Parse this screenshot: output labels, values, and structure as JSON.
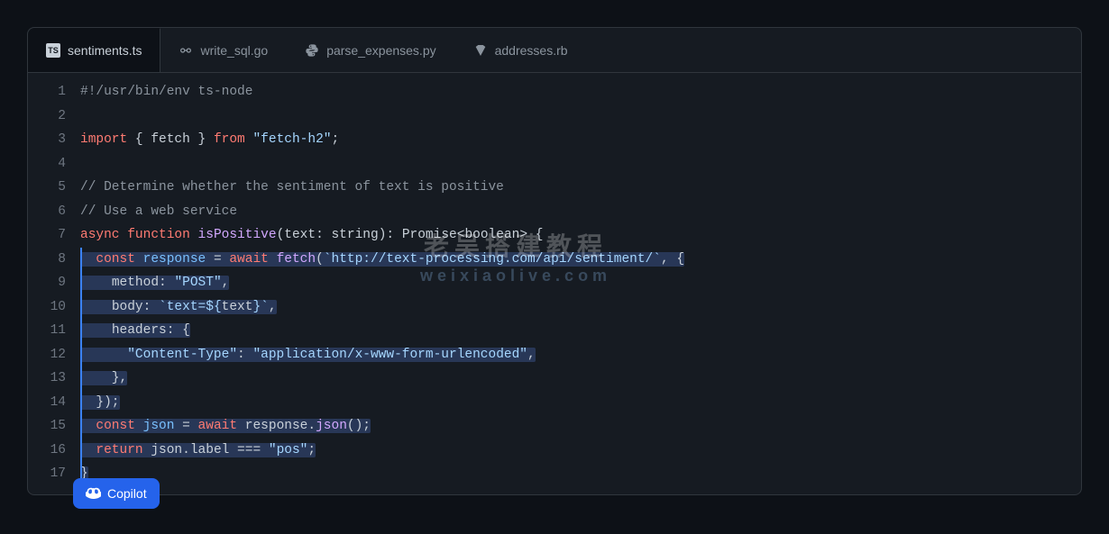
{
  "tabs": [
    {
      "label": "sentiments.ts",
      "icon": "ts-icon",
      "active": true
    },
    {
      "label": "write_sql.go",
      "icon": "go-icon",
      "active": false
    },
    {
      "label": "parse_expenses.py",
      "icon": "python-icon",
      "active": false
    },
    {
      "label": "addresses.rb",
      "icon": "ruby-icon",
      "active": false
    }
  ],
  "copilot_label": "Copilot",
  "watermark": {
    "line1": "老吴搭建教程",
    "line2": "weixiaolive.com"
  },
  "code": {
    "lines": [
      {
        "n": 1,
        "sel": false,
        "tokens": [
          [
            "comment",
            "#!/usr/bin/env ts-node"
          ]
        ]
      },
      {
        "n": 2,
        "sel": false,
        "tokens": []
      },
      {
        "n": 3,
        "sel": false,
        "tokens": [
          [
            "keyword",
            "import"
          ],
          [
            "punc",
            " { "
          ],
          [
            "var",
            "fetch"
          ],
          [
            "punc",
            " } "
          ],
          [
            "keyword",
            "from"
          ],
          [
            "punc",
            " "
          ],
          [
            "string",
            "\"fetch-h2\""
          ],
          [
            "punc",
            ";"
          ]
        ]
      },
      {
        "n": 4,
        "sel": false,
        "tokens": []
      },
      {
        "n": 5,
        "sel": false,
        "tokens": [
          [
            "comment",
            "// Determine whether the sentiment of text is positive"
          ]
        ]
      },
      {
        "n": 6,
        "sel": false,
        "tokens": [
          [
            "comment",
            "// Use a web service"
          ]
        ]
      },
      {
        "n": 7,
        "sel": false,
        "tokens": [
          [
            "keyword",
            "async"
          ],
          [
            "punc",
            " "
          ],
          [
            "keyword",
            "function"
          ],
          [
            "punc",
            " "
          ],
          [
            "func",
            "isPositive"
          ],
          [
            "punc",
            "("
          ],
          [
            "var",
            "text"
          ],
          [
            "punc",
            ": "
          ],
          [
            "type",
            "string"
          ],
          [
            "punc",
            "): "
          ],
          [
            "type",
            "Promise"
          ],
          [
            "punc",
            "<"
          ],
          [
            "type",
            "boolean"
          ],
          [
            "punc",
            "> {"
          ]
        ]
      },
      {
        "n": 8,
        "sel": true,
        "tokens": [
          [
            "punc",
            "  "
          ],
          [
            "keyword",
            "const"
          ],
          [
            "punc",
            " "
          ],
          [
            "ident",
            "response"
          ],
          [
            "punc",
            " = "
          ],
          [
            "keyword",
            "await"
          ],
          [
            "punc",
            " "
          ],
          [
            "func",
            "fetch"
          ],
          [
            "punc",
            "("
          ],
          [
            "string",
            "`http://text-processing.com/api/sentiment/`"
          ],
          [
            "punc",
            ", {"
          ]
        ]
      },
      {
        "n": 9,
        "sel": true,
        "tokens": [
          [
            "punc",
            "    "
          ],
          [
            "var",
            "method"
          ],
          [
            "punc",
            ": "
          ],
          [
            "string",
            "\"POST\""
          ],
          [
            "punc",
            ","
          ]
        ]
      },
      {
        "n": 10,
        "sel": true,
        "tokens": [
          [
            "punc",
            "    "
          ],
          [
            "var",
            "body"
          ],
          [
            "punc",
            ": "
          ],
          [
            "string",
            "`text=${"
          ],
          [
            "var",
            "text"
          ],
          [
            "string",
            "}`"
          ],
          [
            "punc",
            ","
          ]
        ]
      },
      {
        "n": 11,
        "sel": true,
        "tokens": [
          [
            "punc",
            "    "
          ],
          [
            "var",
            "headers"
          ],
          [
            "punc",
            ": {"
          ]
        ]
      },
      {
        "n": 12,
        "sel": true,
        "tokens": [
          [
            "punc",
            "      "
          ],
          [
            "string",
            "\"Content-Type\""
          ],
          [
            "punc",
            ": "
          ],
          [
            "string",
            "\"application/x-www-form-urlencoded\""
          ],
          [
            "punc",
            ","
          ]
        ]
      },
      {
        "n": 13,
        "sel": true,
        "tokens": [
          [
            "punc",
            "    },"
          ]
        ]
      },
      {
        "n": 14,
        "sel": true,
        "tokens": [
          [
            "punc",
            "  });"
          ]
        ]
      },
      {
        "n": 15,
        "sel": true,
        "tokens": [
          [
            "punc",
            "  "
          ],
          [
            "keyword",
            "const"
          ],
          [
            "punc",
            " "
          ],
          [
            "ident",
            "json"
          ],
          [
            "punc",
            " = "
          ],
          [
            "keyword",
            "await"
          ],
          [
            "punc",
            " "
          ],
          [
            "var",
            "response"
          ],
          [
            "punc",
            "."
          ],
          [
            "func",
            "json"
          ],
          [
            "punc",
            "();"
          ]
        ]
      },
      {
        "n": 16,
        "sel": true,
        "tokens": [
          [
            "punc",
            "  "
          ],
          [
            "keyword",
            "return"
          ],
          [
            "punc",
            " "
          ],
          [
            "var",
            "json"
          ],
          [
            "punc",
            "."
          ],
          [
            "var",
            "label"
          ],
          [
            "punc",
            " === "
          ],
          [
            "string",
            "\"pos\""
          ],
          [
            "punc",
            ";"
          ]
        ]
      },
      {
        "n": 17,
        "sel": true,
        "tokens": [
          [
            "punc",
            "}"
          ]
        ]
      }
    ]
  }
}
